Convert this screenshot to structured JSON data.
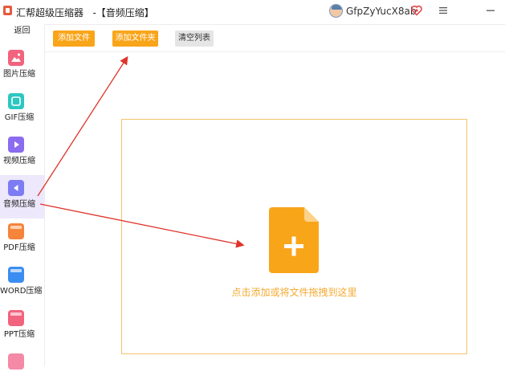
{
  "titlebar": {
    "app_title": "汇帮超级压缩器   -【音频压缩】",
    "username": "GfpZyYucX8ab"
  },
  "sidebar": {
    "back_label": "返回",
    "items": [
      {
        "label": "图片压缩",
        "icon": "image-icon",
        "color": "#f2637e"
      },
      {
        "label": "GIF压缩",
        "icon": "gif-icon",
        "color": "#2cc7c1"
      },
      {
        "label": "视频压缩",
        "icon": "video-icon",
        "color": "#8b6cf0"
      },
      {
        "label": "音频压缩",
        "icon": "audio-icon",
        "color": "#7d7cf5"
      },
      {
        "label": "PDF压缩",
        "icon": "pdf-icon",
        "color": "#f6843a"
      },
      {
        "label": "WORD压缩",
        "icon": "word-icon",
        "color": "#3b8df2"
      },
      {
        "label": "PPT压缩",
        "icon": "ppt-icon",
        "color": "#f2637e"
      }
    ],
    "active": "音频压缩"
  },
  "toolbar": {
    "add_file_label": "添加文件",
    "add_folder_label": "添加文件夹",
    "clear_list_label": "清空列表"
  },
  "dropzone": {
    "hint": "点击添加或将文件拖拽到这里"
  },
  "colors": {
    "accent": "#f9a51a",
    "annotation_arrow": "#e0332b",
    "active_sidebar_bg": "#ede8fb"
  }
}
